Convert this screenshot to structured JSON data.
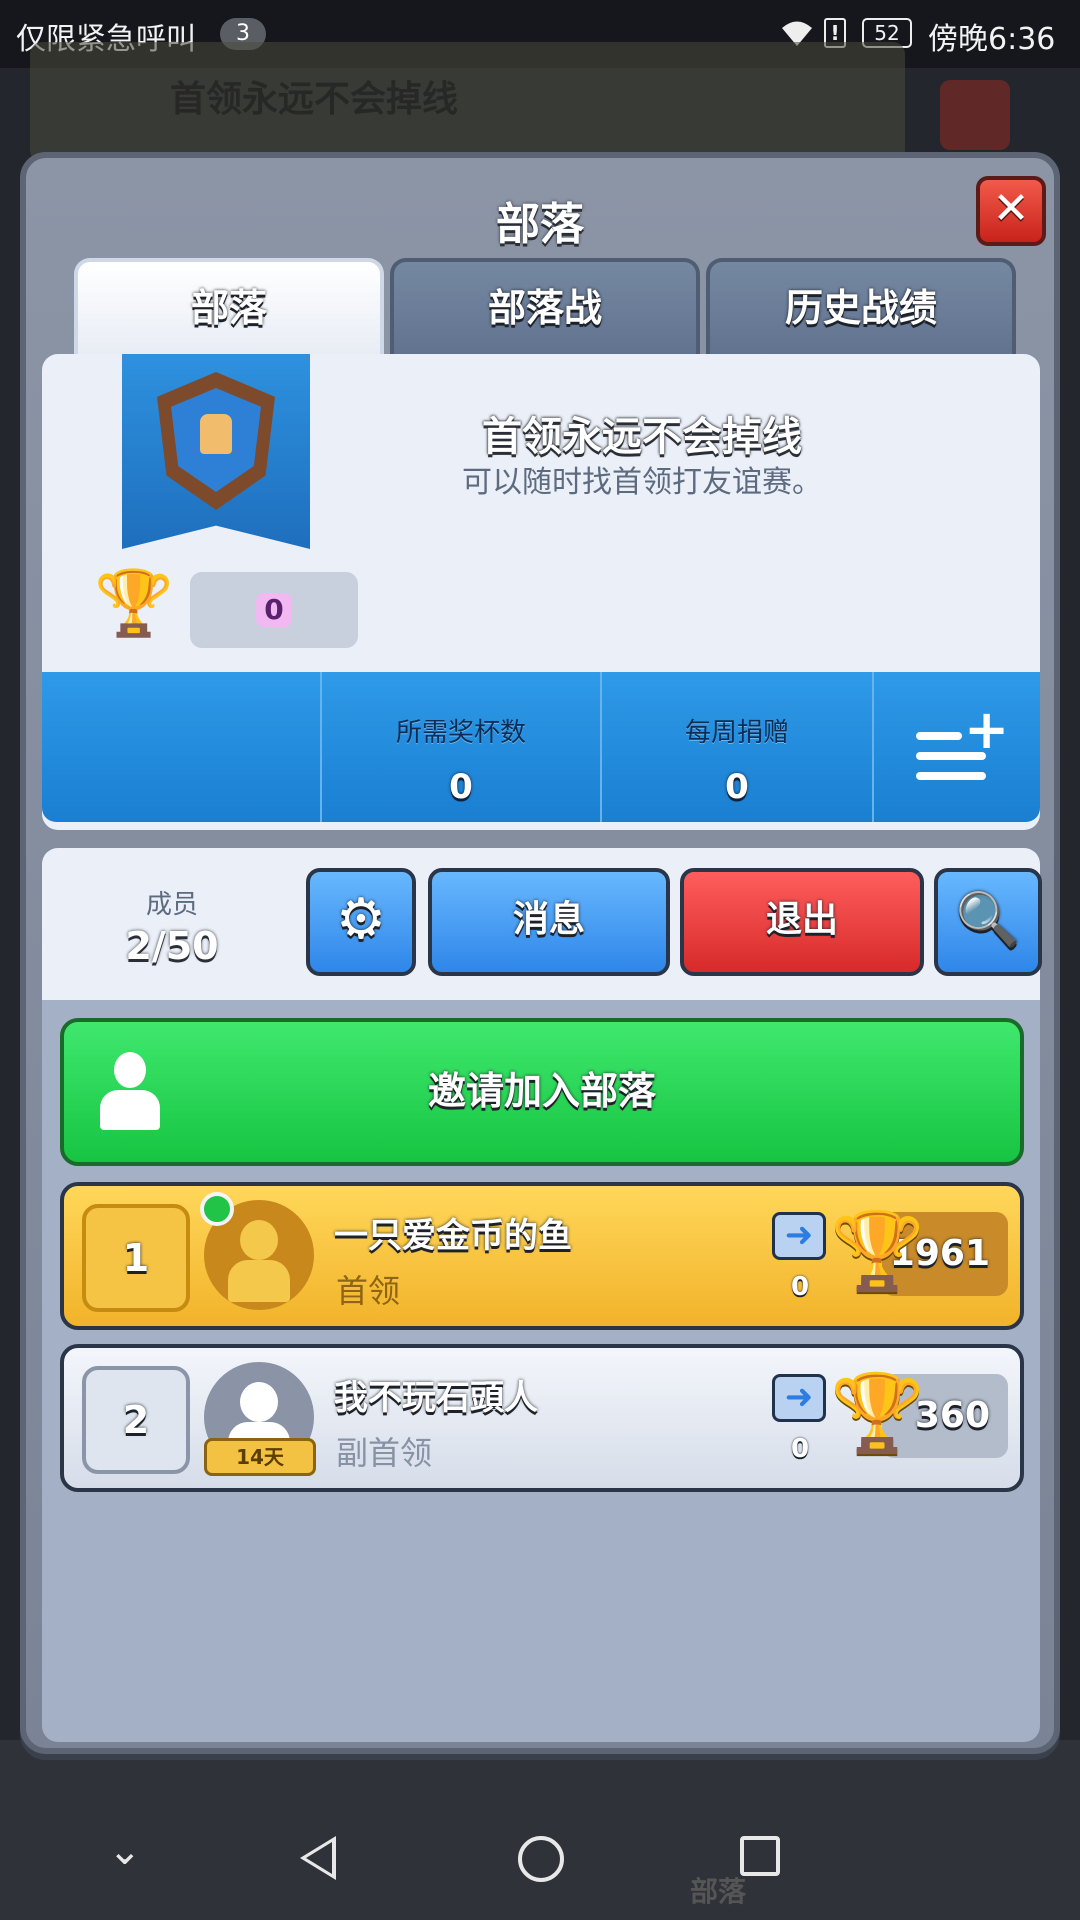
{
  "status_bar": {
    "carrier": "仅限紧急呼叫",
    "notif_count": "3",
    "battery": "52",
    "time": "傍晚6:36"
  },
  "background": {
    "clan_title": "首领永远不会掉线",
    "bottom_tab_label": "部落"
  },
  "dialog": {
    "title": "部落",
    "close_label": "✕",
    "tabs": [
      {
        "label": "部落",
        "active": true
      },
      {
        "label": "部落战",
        "active": false
      },
      {
        "label": "历史战绩",
        "active": false
      }
    ]
  },
  "clan": {
    "name": "首领永远不会掉线",
    "description": "可以随时找首领打友谊赛。",
    "trophies": "0",
    "stats": {
      "required_trophies_label": "所需奖杯数",
      "required_trophies_value": "0",
      "weekly_donations_label": "每周捐赠",
      "weekly_donations_value": "0"
    }
  },
  "members_toolbar": {
    "members_label": "成员",
    "members_count": "2/50",
    "message_label": "消息",
    "exit_label": "退出",
    "settings_icon": "⚙",
    "search_icon": "🔍"
  },
  "invite": {
    "label": "邀请加入部落"
  },
  "members": [
    {
      "rank": "1",
      "name": "一只爱金币的鱼",
      "role": "首领",
      "donations": "0",
      "trophies": "1961"
    },
    {
      "rank": "2",
      "name": "我不玩石頭人",
      "role": "副首领",
      "donations": "0",
      "trophies": "360",
      "days_badge": "14天"
    }
  ],
  "colors": {
    "accent_blue": "#2e86e8",
    "exit_red": "#d72a2a",
    "invite_green": "#17c442",
    "leader_gold": "#f2b32a"
  }
}
